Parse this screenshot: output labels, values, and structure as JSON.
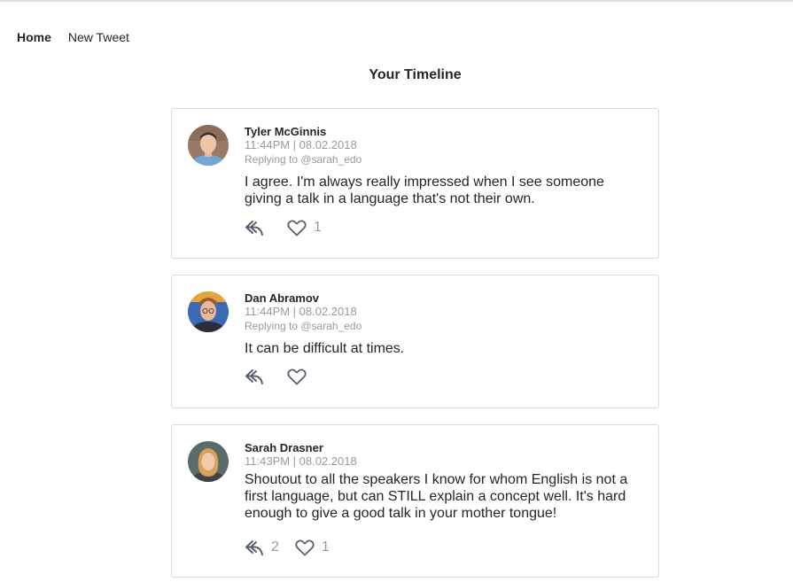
{
  "nav": {
    "home": "Home",
    "new_tweet": "New Tweet"
  },
  "page_title": "Your Timeline",
  "tweets": [
    {
      "author": "Tyler McGinnis",
      "time": "11:44PM | 08.02.2018",
      "replying_to": "Replying to @sarah_edo",
      "text": "I agree. I'm always really impressed when I see someone giving a talk in a language that's not their own.",
      "reply_count": "",
      "like_count": "1"
    },
    {
      "author": "Dan Abramov",
      "time": "11:44PM | 08.02.2018",
      "replying_to": "Replying to @sarah_edo",
      "text": "It can be difficult at times.",
      "reply_count": "",
      "like_count": ""
    },
    {
      "author": "Sarah Drasner",
      "time": "11:43PM | 08.02.2018",
      "replying_to": "",
      "text": "Shoutout to all the speakers I know for whom English is not a first language, but can STILL explain a concept well. It's hard enough to give a good talk in your mother tongue!",
      "reply_count": "2",
      "like_count": "1"
    }
  ],
  "colors": {
    "text": "#252525",
    "muted": "#9a9a9a",
    "border": "#dadada",
    "icon": "#595f6e"
  },
  "icons": {
    "reply": "reply-icon",
    "like": "heart-icon"
  }
}
